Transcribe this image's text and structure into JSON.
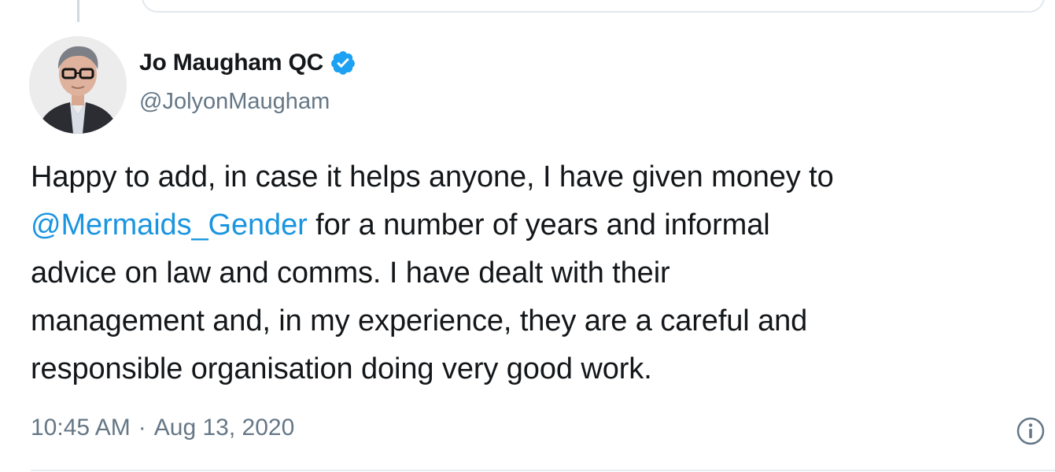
{
  "tweet": {
    "author": {
      "display_name": "Jo Maugham QC",
      "handle": "@JolyonMaugham",
      "verified": true,
      "avatar_icon": "profile-photo-avatar"
    },
    "text": {
      "part_before_mention": "Happy to add, in case it helps anyone, I have given money to",
      "mention": "@Mermaids_Gender",
      "part_after_mention_line2": "for a number of years and informal",
      "line3": "advice on law and comms. I have dealt with their",
      "line4": "management and, in my experience, they are a careful and",
      "line5": "responsible organisation doing very good work."
    },
    "time": "10:45 AM",
    "separator": "·",
    "date": "Aug 13, 2020",
    "info_icon": "info-icon"
  },
  "colors": {
    "text": "#14171a",
    "secondary": "#657786",
    "link": "#1b95e0",
    "verified": "#1da1f2",
    "divider": "#e6ecf0"
  }
}
